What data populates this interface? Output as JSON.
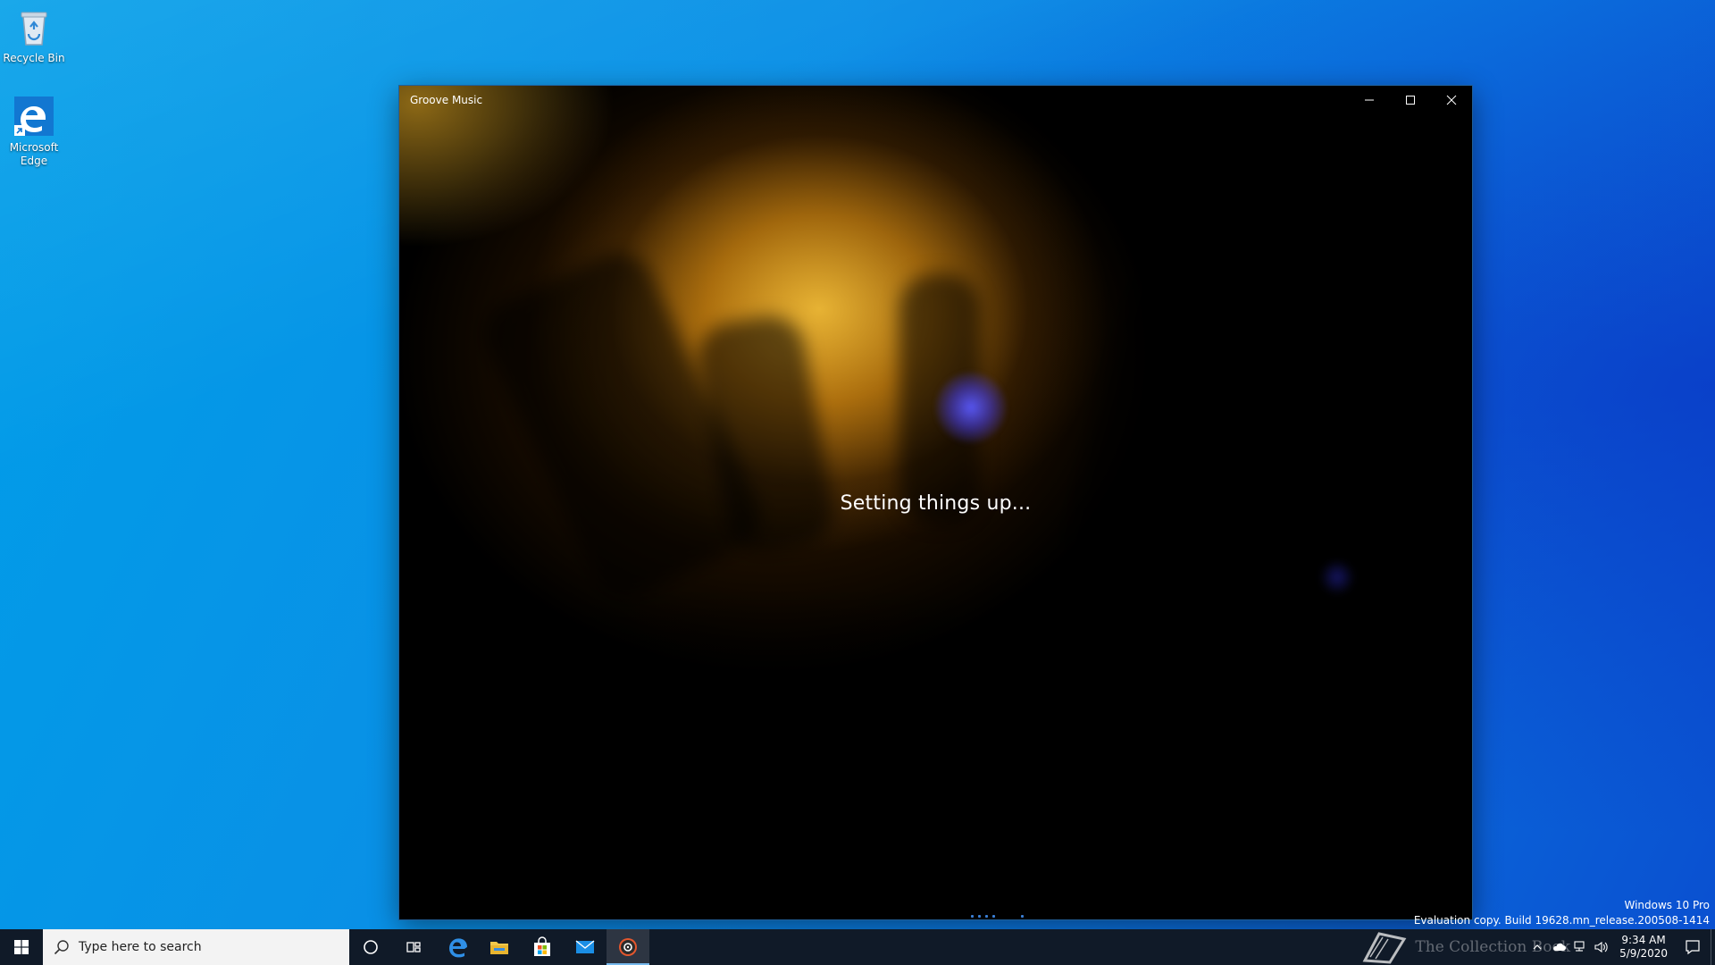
{
  "desktop": {
    "icons": [
      {
        "label": "Recycle Bin",
        "icon": "recycle-bin-icon"
      },
      {
        "label": "Microsoft Edge",
        "icon": "edge-icon"
      }
    ]
  },
  "window": {
    "title": "Groove Music",
    "minimize": "minimize-icon",
    "maximize": "maximize-icon",
    "close": "close-icon",
    "status_text": "Setting things up..."
  },
  "watermark": {
    "line1": "Windows 10 Pro",
    "line2": "Evaluation copy. Build 19628.mn_release.200508-1414"
  },
  "taskbar": {
    "search_placeholder": "Type here to search",
    "pinned": [
      "cortana-icon",
      "task-view-icon",
      "edge-icon",
      "file-explorer-icon",
      "store-icon",
      "mail-icon",
      "groove-music-icon"
    ],
    "clock_time": "9:34 AM",
    "clock_date": "5/9/2020",
    "overlay_text": "The Collection Book"
  },
  "colors": {
    "desktop_accent": "#0a8fe6",
    "taskbar_bg": "#101a28",
    "active_underline": "#76b9ed"
  }
}
